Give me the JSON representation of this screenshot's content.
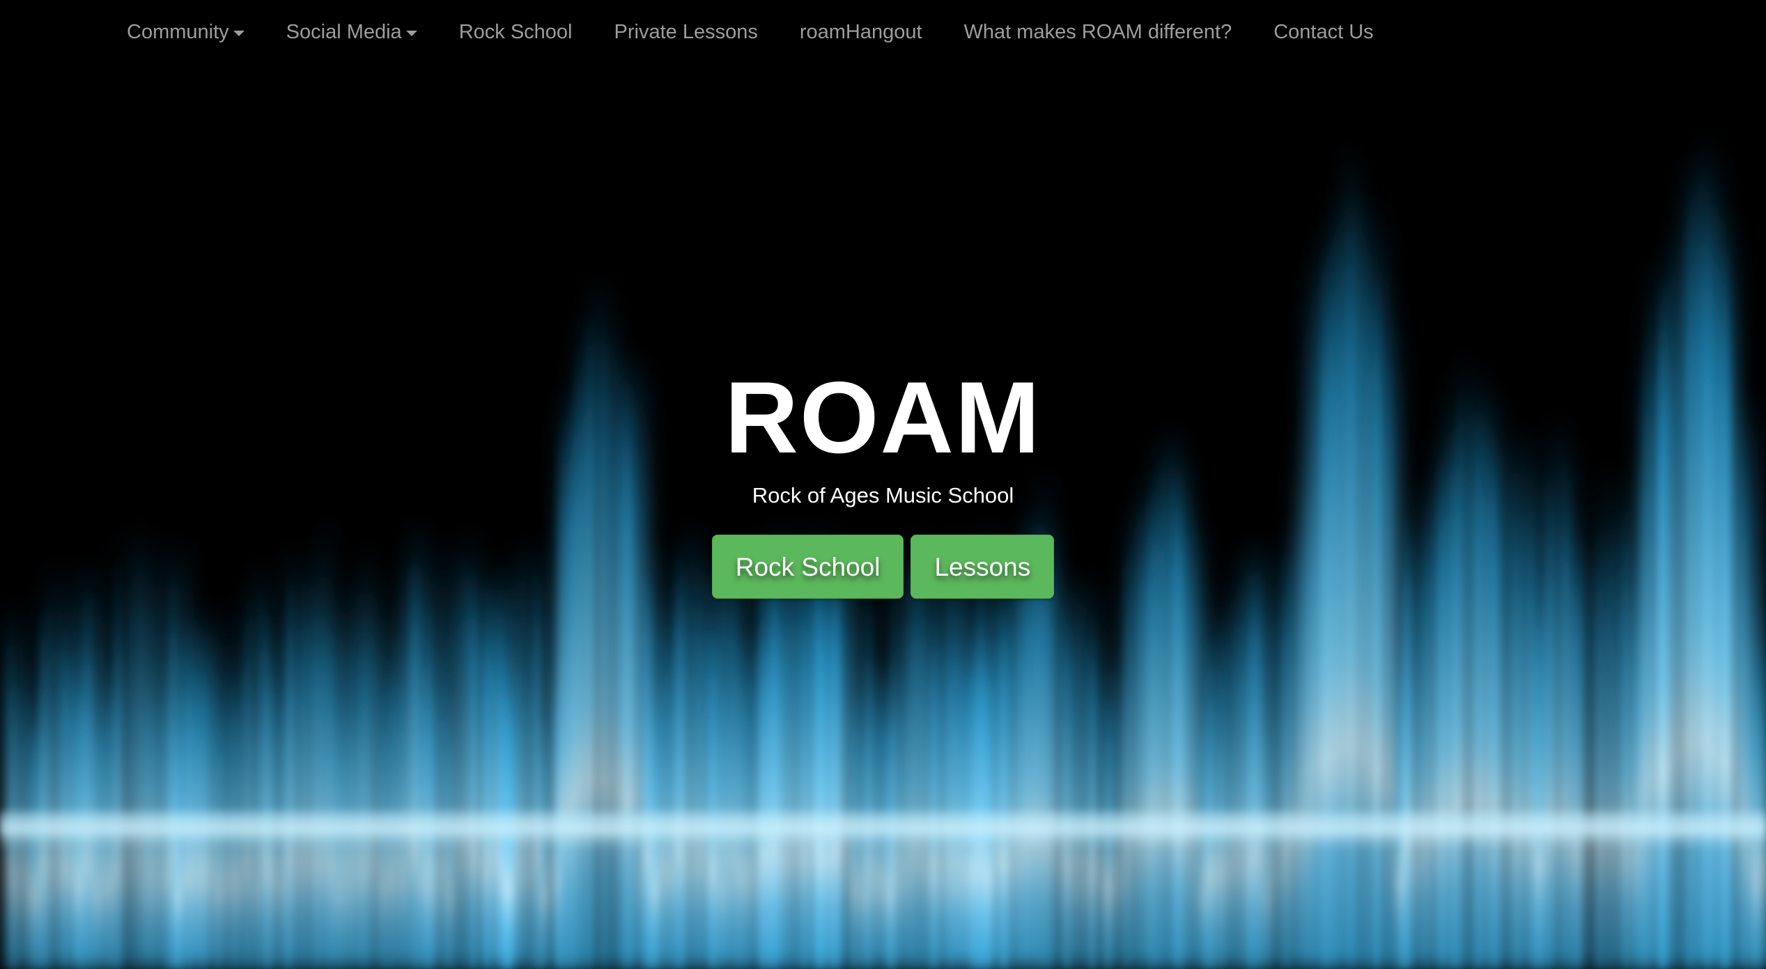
{
  "nav": {
    "items": [
      {
        "label": "Community",
        "dropdown": true
      },
      {
        "label": "Social Media",
        "dropdown": true
      },
      {
        "label": "Rock School",
        "dropdown": false
      },
      {
        "label": "Private Lessons",
        "dropdown": false
      },
      {
        "label": "roamHangout",
        "dropdown": false
      },
      {
        "label": "What makes ROAM different?",
        "dropdown": false
      },
      {
        "label": "Contact Us",
        "dropdown": false
      }
    ]
  },
  "hero": {
    "title": "ROAM",
    "subtitle": "Rock of Ages Music School",
    "buttons": {
      "rock_school_label": "Rock School",
      "lessons_label": "Lessons"
    }
  },
  "colors": {
    "nav_text": "#9d9d9d",
    "button_green": "#5cb85c",
    "wave_blue": "#4cc3ff",
    "background": "#000000"
  }
}
